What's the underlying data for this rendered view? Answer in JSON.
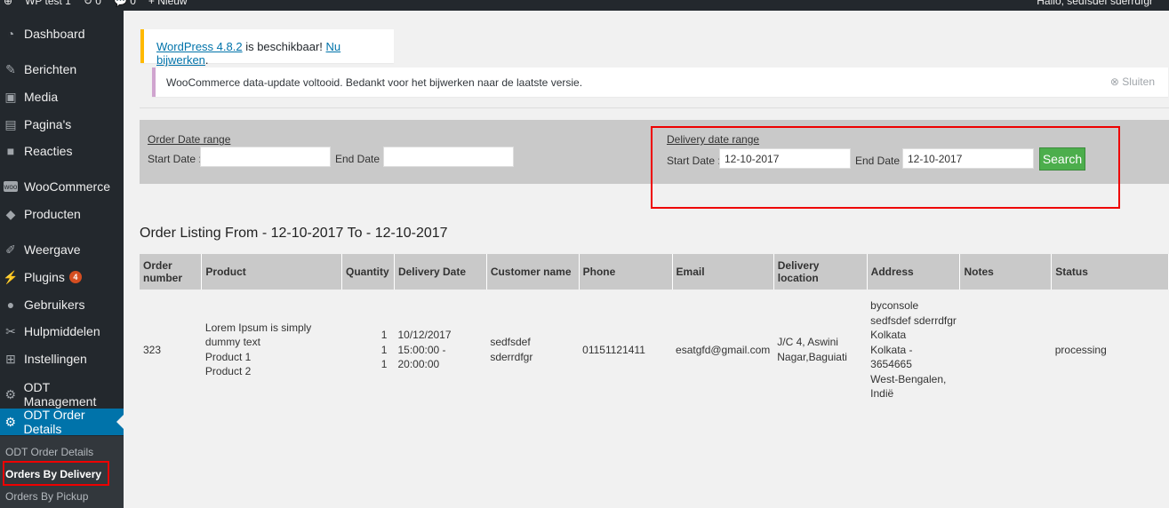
{
  "adminbar": {
    "site_name": "WP test 1",
    "updates_count": "0",
    "comments_count": "0",
    "new_label": "Nieuw",
    "greeting": "Hallo, sedfsdef sderrdfgr"
  },
  "sidebar": {
    "items": [
      {
        "label": "Dashboard",
        "icon": "dashboard-icon"
      },
      {
        "label": "Berichten",
        "icon": "pin-icon"
      },
      {
        "label": "Media",
        "icon": "media-icon"
      },
      {
        "label": "Pagina's",
        "icon": "pages-icon"
      },
      {
        "label": "Reacties",
        "icon": "comments-icon"
      },
      {
        "label": "WooCommerce",
        "icon": "woocommerce-icon"
      },
      {
        "label": "Producten",
        "icon": "products-icon"
      },
      {
        "label": "Weergave",
        "icon": "appearance-icon"
      },
      {
        "label": "Plugins",
        "icon": "plugins-icon",
        "badge": "4"
      },
      {
        "label": "Gebruikers",
        "icon": "users-icon"
      },
      {
        "label": "Hulpmiddelen",
        "icon": "tools-icon"
      },
      {
        "label": "Instellingen",
        "icon": "settings-icon"
      },
      {
        "label": "ODT Management",
        "icon": "gear-icon"
      },
      {
        "label": "ODT Order Details",
        "icon": "gear-icon"
      }
    ],
    "submenu": [
      "ODT Order Details",
      "Orders By Delivery",
      "Orders By Pickup"
    ]
  },
  "notices": {
    "update_link": "WordPress 4.8.2",
    "update_text": " is beschikbaar! ",
    "update_now": "Nu bijwerken",
    "update_end": ".",
    "woo_text": "WooCommerce data-update voltooid. Bedankt voor het bijwerken naar de laatste versie.",
    "dismiss_label": "Sluiten"
  },
  "filter": {
    "order_range_title": "Order Date range",
    "delivery_range_title": "Delivery date range",
    "start_label": "Start Date :",
    "end_label": "End Date :",
    "order_start_value": "",
    "order_end_value": "",
    "delivery_start_value": "12-10-2017",
    "delivery_end_value": "12-10-2017",
    "search_label": "Search"
  },
  "listing_title": "Order Listing From - 12-10-2017 To - 12-10-2017",
  "table": {
    "headers": [
      "Order number",
      "Product",
      "Quantity",
      "Delivery Date",
      "Customer name",
      "Phone",
      "Email",
      "Delivery location",
      "Address",
      "Notes",
      "Status"
    ],
    "rows": [
      {
        "order_number": "323",
        "products": [
          "Lorem Ipsum is simply dummy text",
          "Product 1",
          "Product 2"
        ],
        "quantities": [
          "1",
          "1",
          "1"
        ],
        "delivery_date": [
          "10/12/2017",
          "15:00:00 -",
          "20:00:00"
        ],
        "customer": "sedfsdef sderrdfgr",
        "phone": "01151121411",
        "email": "esatgfd@gmail.com",
        "location": [
          "J/C 4, Aswini",
          "Nagar,Baguiati"
        ],
        "address": [
          "byconsole",
          "sedfsdef sderrdfgr",
          "Kolkata",
          "Kolkata - 3654665",
          "West-Bengalen,",
          "Indië"
        ],
        "notes": "",
        "status": "processing"
      }
    ]
  },
  "colors": {
    "admin_dark": "#23282d",
    "active_blue": "#0073aa",
    "search_green": "#4cae4c",
    "highlight_red": "#e00000"
  }
}
